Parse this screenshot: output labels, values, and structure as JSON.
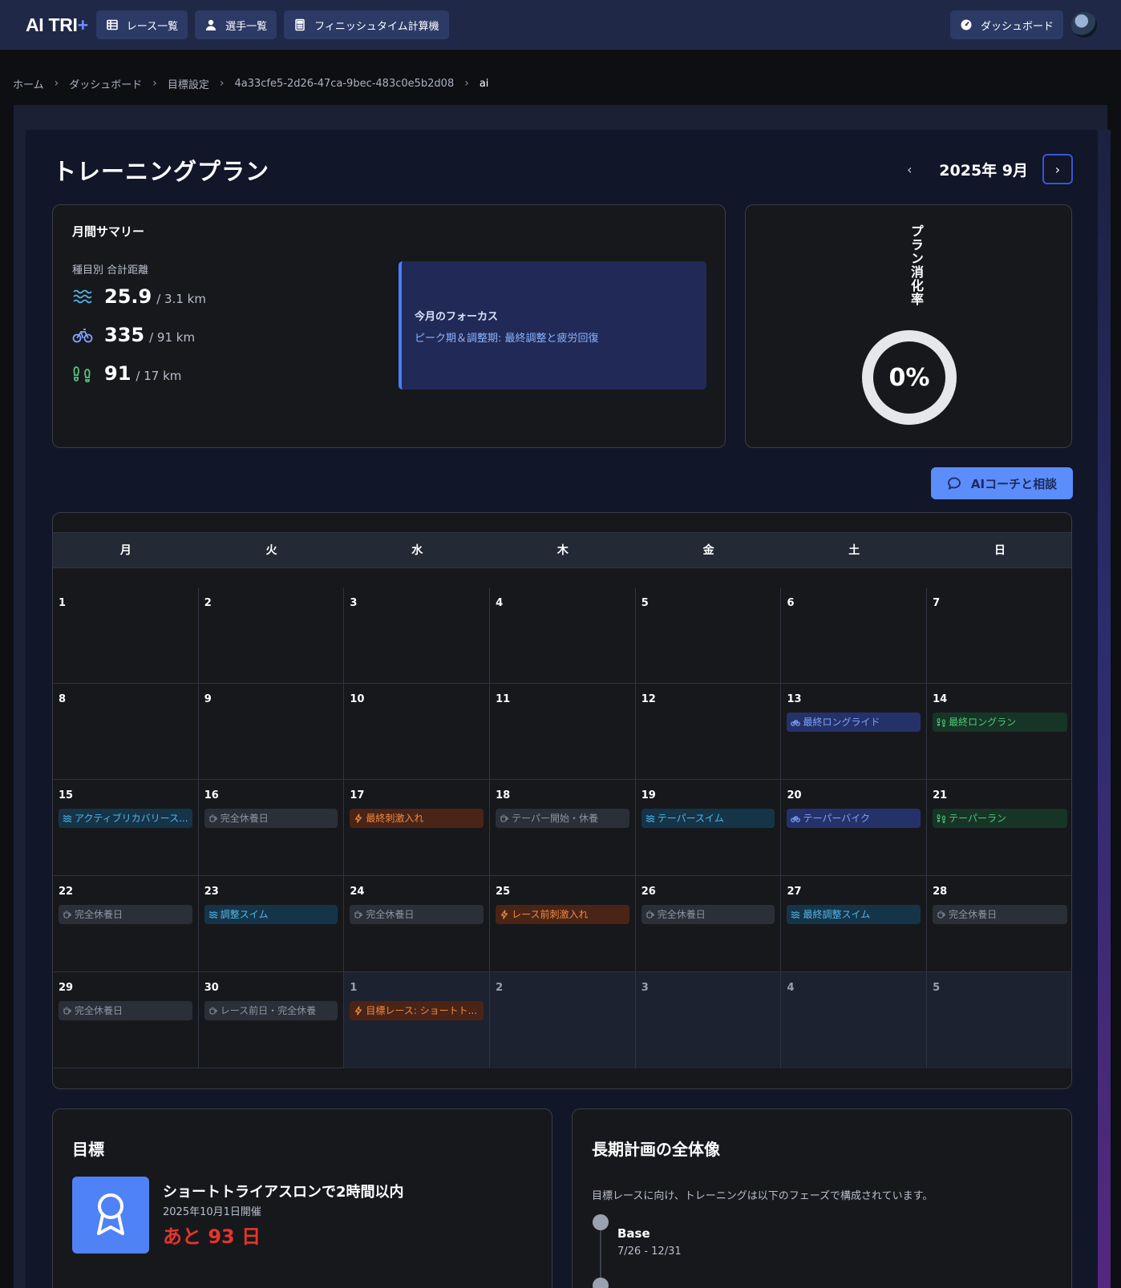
{
  "nav": {
    "logo_main": "AI TRI",
    "logo_plus": "+",
    "items": [
      {
        "label": "レース一覧",
        "icon": "table-icon"
      },
      {
        "label": "選手一覧",
        "icon": "user-icon"
      },
      {
        "label": "フィニッシュタイム計算機",
        "icon": "calculator-icon"
      }
    ],
    "dashboard_label": "ダッシュボード"
  },
  "breadcrumb": [
    "ホーム",
    "ダッシュボード",
    "目標設定",
    "4a33cfe5-2d26-47ca-9bec-483c0e5b2d08",
    "ai"
  ],
  "page": {
    "title": "トレーニングプラン",
    "month_label": "2025年 9月",
    "prev_glyph": "‹",
    "next_glyph": "›"
  },
  "summary": {
    "title": "月間サマリー",
    "subtitle": "種目別 合計距離",
    "swim": {
      "value": "25.9",
      "rest": "/ 3.1 km"
    },
    "bike": {
      "value": "335",
      "rest": "/ 91 km"
    },
    "run": {
      "value": "91",
      "rest": "/ 17 km"
    },
    "focus_title": "今月のフォーカス",
    "focus_text": "ピーク期＆調整期: 最終調整と疲労回復"
  },
  "progress": {
    "title": "プラン消化率",
    "label": "0%",
    "value": 0
  },
  "ai_button": "AIコーチと相談",
  "calendar": {
    "weekdays": [
      "月",
      "火",
      "水",
      "木",
      "金",
      "土",
      "日"
    ],
    "weeks": [
      [
        {
          "d": "1"
        },
        {
          "d": "2"
        },
        {
          "d": "3"
        },
        {
          "d": "4"
        },
        {
          "d": "5"
        },
        {
          "d": "6"
        },
        {
          "d": "7"
        }
      ],
      [
        {
          "d": "8"
        },
        {
          "d": "9"
        },
        {
          "d": "10"
        },
        {
          "d": "11"
        },
        {
          "d": "12"
        },
        {
          "d": "13",
          "ev": {
            "type": "bike",
            "label": "最終ロングライド"
          }
        },
        {
          "d": "14",
          "ev": {
            "type": "run",
            "label": "最終ロングラン"
          }
        }
      ],
      [
        {
          "d": "15",
          "ev": {
            "type": "swim",
            "label": "アクティブリカバリース..."
          }
        },
        {
          "d": "16",
          "ev": {
            "type": "rest",
            "label": "完全休養日"
          }
        },
        {
          "d": "17",
          "ev": {
            "type": "hard",
            "label": "最終刺激入れ"
          }
        },
        {
          "d": "18",
          "ev": {
            "type": "rest",
            "label": "テーパー開始・休養"
          }
        },
        {
          "d": "19",
          "ev": {
            "type": "swim",
            "label": "テーパースイム"
          }
        },
        {
          "d": "20",
          "ev": {
            "type": "bike",
            "label": "テーパーバイク"
          }
        },
        {
          "d": "21",
          "ev": {
            "type": "run",
            "label": "テーパーラン"
          }
        }
      ],
      [
        {
          "d": "22",
          "ev": {
            "type": "rest",
            "label": "完全休養日"
          }
        },
        {
          "d": "23",
          "ev": {
            "type": "swim",
            "label": "調整スイム"
          }
        },
        {
          "d": "24",
          "ev": {
            "type": "rest",
            "label": "完全休養日"
          }
        },
        {
          "d": "25",
          "ev": {
            "type": "hard",
            "label": "レース前刺激入れ"
          }
        },
        {
          "d": "26",
          "ev": {
            "type": "rest",
            "label": "完全休養日"
          }
        },
        {
          "d": "27",
          "ev": {
            "type": "swim",
            "label": "最終調整スイム"
          }
        },
        {
          "d": "28",
          "ev": {
            "type": "rest",
            "label": "完全休養日"
          }
        }
      ],
      [
        {
          "d": "29",
          "ev": {
            "type": "rest",
            "label": "完全休養日"
          }
        },
        {
          "d": "30",
          "ev": {
            "type": "rest",
            "label": "レース前日・完全休養"
          }
        },
        {
          "d": "1",
          "other": true,
          "ev": {
            "type": "hard",
            "label": "目標レース: ショートト..."
          }
        },
        {
          "d": "2",
          "other": true
        },
        {
          "d": "3",
          "other": true
        },
        {
          "d": "4",
          "other": true
        },
        {
          "d": "5",
          "other": true
        }
      ]
    ]
  },
  "goal": {
    "title": "目標",
    "name": "ショートトライアスロンで2時間以内",
    "date": "2025年10月1日開催",
    "countdown": "あと 93 日"
  },
  "longterm": {
    "title": "長期計画の全体像",
    "desc": "目標レースに向け、トレーニングは以下のフェーズで構成されています。",
    "phases": [
      {
        "name": "Base",
        "range": "7/26 - 12/31"
      }
    ]
  },
  "colors": {
    "accent": "#4f82f7",
    "swim": "#52b6e8",
    "bike": "#7ea3ff",
    "run": "#50c878",
    "hard": "#f08a44",
    "countdown": "#e5352b"
  }
}
